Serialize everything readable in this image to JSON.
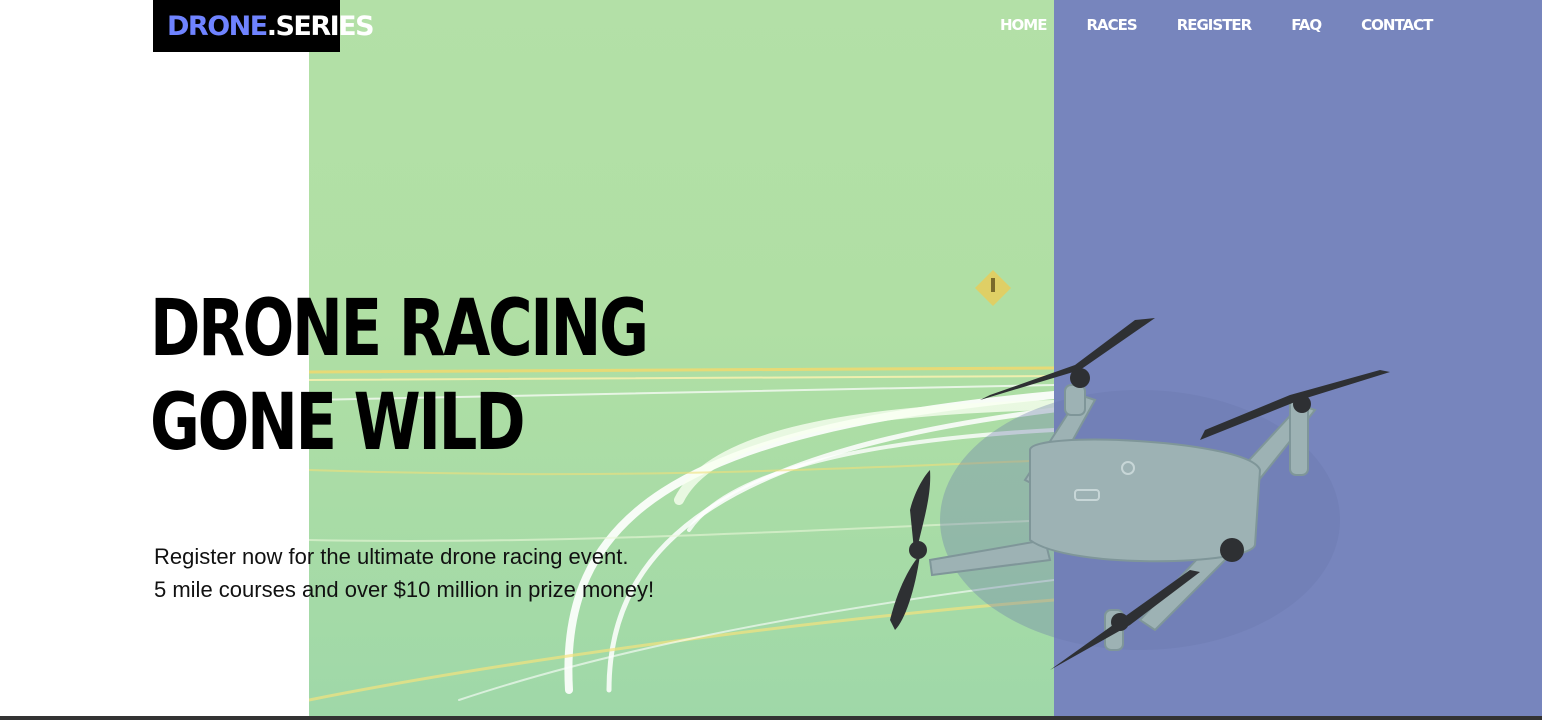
{
  "brand": {
    "part1": "DRONE",
    "part2": ".SERIES"
  },
  "nav": {
    "items": [
      {
        "id": "home",
        "label": "HOME"
      },
      {
        "id": "races",
        "label": "RACES"
      },
      {
        "id": "register",
        "label": "REGISTER"
      },
      {
        "id": "faq",
        "label": "FAQ"
      },
      {
        "id": "contact",
        "label": "CONTACT"
      }
    ]
  },
  "hero": {
    "headline_line1": "DRONE RACING",
    "headline_line2": "GONE WILD",
    "sub_line1": "Register now for the ultimate drone racing event.",
    "sub_line2": "5 mile courses and over $10 million in prize money!"
  },
  "colors": {
    "brand_accent": "#6f83ff",
    "green_panel": "#b3e0a7",
    "purple_panel": "#7785bd",
    "logo_bg": "#000000"
  },
  "images": {
    "background": "light-trails-road-photo",
    "drone": "quadcopter-drone-photo"
  }
}
